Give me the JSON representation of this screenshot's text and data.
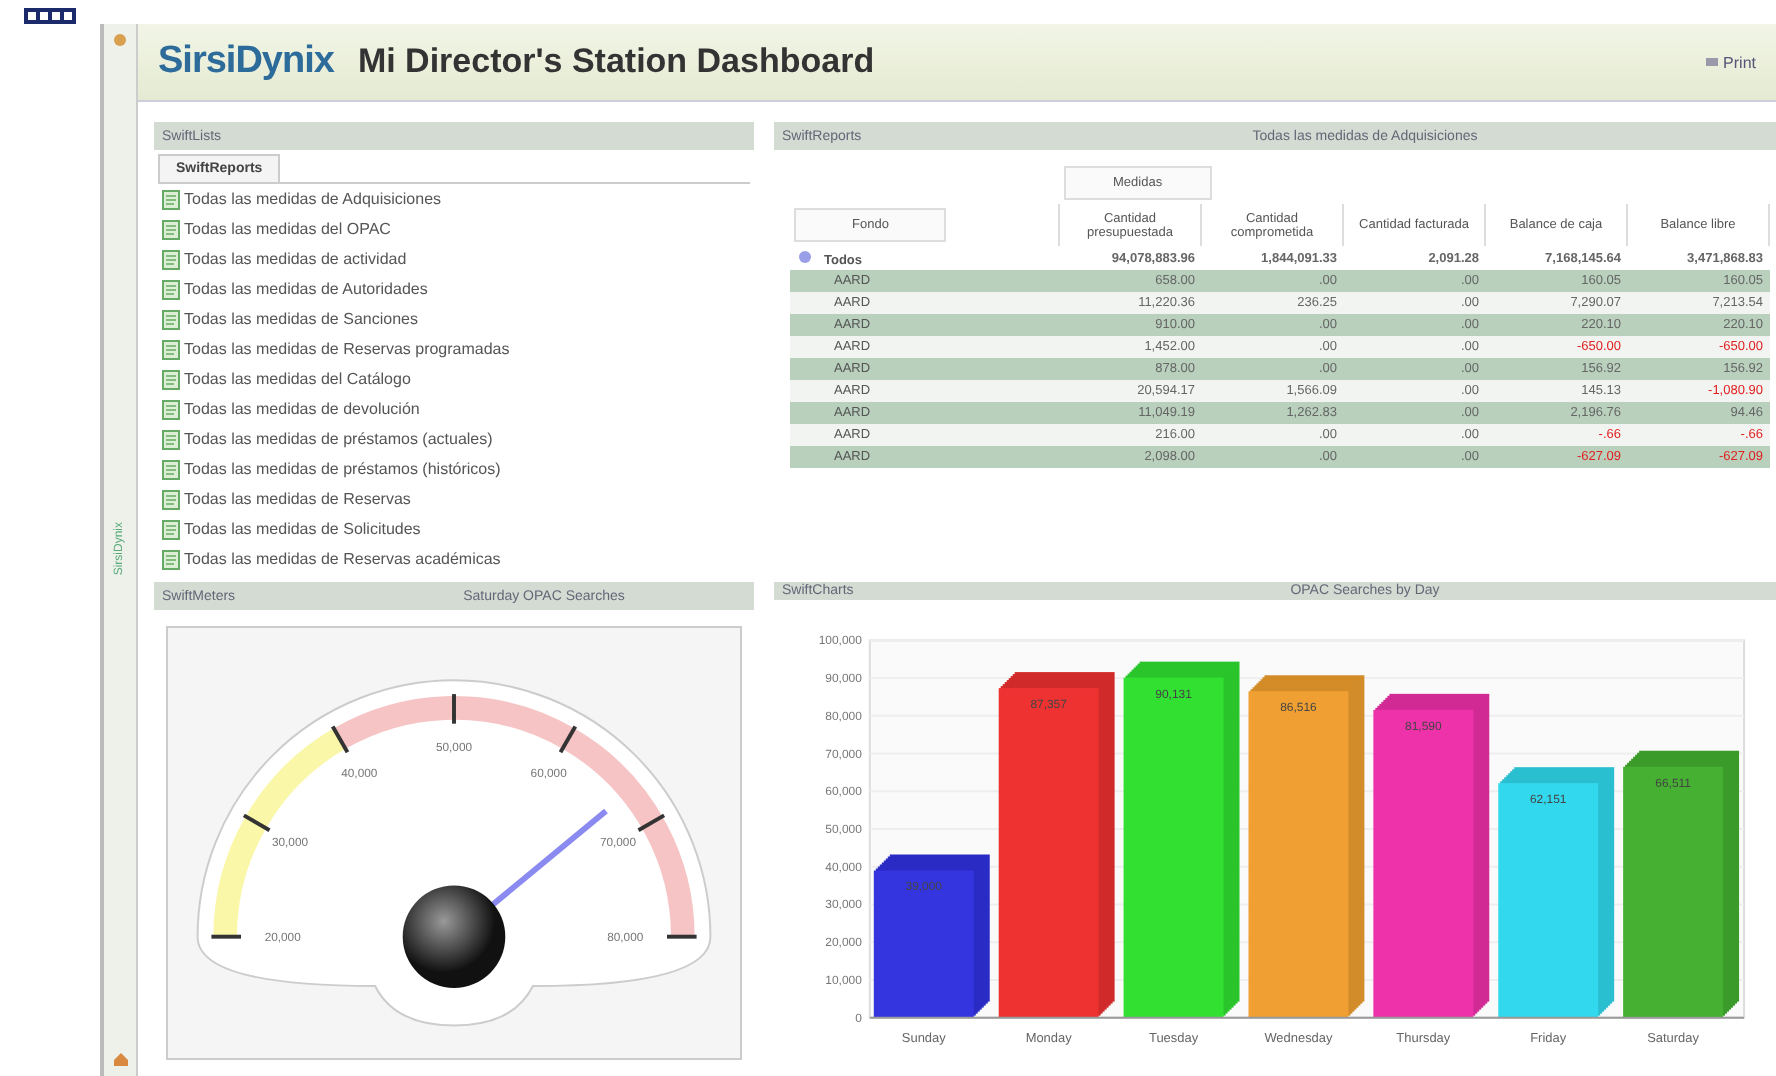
{
  "header": {
    "logo": "SirsiDynix",
    "title": "Mi Director's Station Dashboard",
    "print_label": "Print"
  },
  "side_strip": {
    "label": "SirsiDynix"
  },
  "lists_panel": {
    "title": "SwiftLists",
    "tabs": [
      {
        "label": "SwiftReports",
        "selected": true
      }
    ],
    "items": [
      "Todas las medidas de Adquisiciones",
      "Todas las medidas del OPAC",
      "Todas las medidas de actividad",
      "Todas las medidas de Autoridades",
      "Todas las medidas de Sanciones",
      "Todas las medidas de Reservas programadas",
      "Todas las medidas del Catálogo",
      "Todas las medidas de devolución",
      "Todas las medidas de préstamos (actuales)",
      "Todas las medidas de préstamos (históricos)",
      "Todas las medidas de Reservas",
      "Todas las medidas de Solicitudes",
      "Todas las medidas de Reservas académicas"
    ]
  },
  "report_panel": {
    "name": "SwiftReports",
    "title": "Todas las medidas de Adquisiciones",
    "group_label": "Medidas",
    "row_label": "Fondo",
    "columns": [
      "Cantidad presupuestada",
      "Cantidad comprometida",
      "Cantidad facturada",
      "Balance de caja",
      "Balance libre"
    ],
    "total": {
      "label": "Todos",
      "expanded": true,
      "cells": [
        "94,078,883.96",
        "1,844,091.33",
        "2,091.28",
        "7,168,145.64",
        "3,471,868.83"
      ]
    },
    "rows": [
      {
        "label": "AARD",
        "cells": [
          "658.00",
          ".00",
          ".00",
          "160.05",
          "160.05"
        ]
      },
      {
        "label": "AARD",
        "cells": [
          "11,220.36",
          "236.25",
          ".00",
          "7,290.07",
          "7,213.54"
        ]
      },
      {
        "label": "AARD",
        "cells": [
          "910.00",
          ".00",
          ".00",
          "220.10",
          "220.10"
        ]
      },
      {
        "label": "AARD",
        "cells": [
          "1,452.00",
          ".00",
          ".00",
          {
            "text": "-650.00",
            "negative": true
          },
          {
            "text": "-650.00",
            "negative": true
          }
        ]
      },
      {
        "label": "AARD",
        "cells": [
          "878.00",
          ".00",
          ".00",
          "156.92",
          "156.92"
        ]
      },
      {
        "label": "AARD",
        "cells": [
          "20,594.17",
          "1,566.09",
          ".00",
          "145.13",
          {
            "text": "-1,080.90",
            "negative": true
          }
        ]
      },
      {
        "label": "AARD",
        "cells": [
          "11,049.19",
          "1,262.83",
          ".00",
          "2,196.76",
          "94.46"
        ]
      },
      {
        "label": "AARD",
        "cells": [
          "216.00",
          ".00",
          ".00",
          {
            "text": "-.66",
            "negative": true
          },
          {
            "text": "-.66",
            "negative": true
          }
        ]
      },
      {
        "label": "AARD",
        "cells": [
          "2,098.00",
          ".00",
          ".00",
          {
            "text": "-627.09",
            "negative": true
          },
          {
            "text": "-627.09",
            "negative": true
          }
        ]
      }
    ]
  },
  "meter_panel": {
    "name": "SwiftMeters",
    "title": "Saturday OPAC Searches",
    "ticks": [
      "20,000",
      "30,000",
      "40,000",
      "50,000",
      "60,000",
      "70,000",
      "80,000"
    ]
  },
  "chart_panel": {
    "name": "SwiftCharts",
    "title": "OPAC Searches by Day",
    "chart_data": {
      "type": "bar",
      "categories": [
        "Sunday",
        "Monday",
        "Tuesday",
        "Wednesday",
        "Thursday",
        "Friday",
        "Saturday"
      ],
      "values": [
        39000,
        87357,
        90131,
        86516,
        81590,
        62151,
        66511
      ],
      "value_labels": [
        "39,000",
        "87,357",
        "90,131",
        "86,516",
        "81,590",
        "62,151",
        "66,511"
      ],
      "ylim": [
        0,
        100000
      ],
      "yticks": [
        {
          "value": 0,
          "label": "0"
        },
        {
          "value": 10000,
          "label": "10,000"
        },
        {
          "value": 20000,
          "label": "20,000"
        },
        {
          "value": 30000,
          "label": "30,000"
        },
        {
          "value": 40000,
          "label": "40,000"
        },
        {
          "value": 50000,
          "label": "50,000"
        },
        {
          "value": 60000,
          "label": "60,000"
        },
        {
          "value": 70000,
          "label": "70,000"
        },
        {
          "value": 80000,
          "label": "80,000"
        },
        {
          "value": 90000,
          "label": "90,000"
        },
        {
          "value": 100000,
          "label": "100,000"
        }
      ],
      "grid": true
    }
  }
}
